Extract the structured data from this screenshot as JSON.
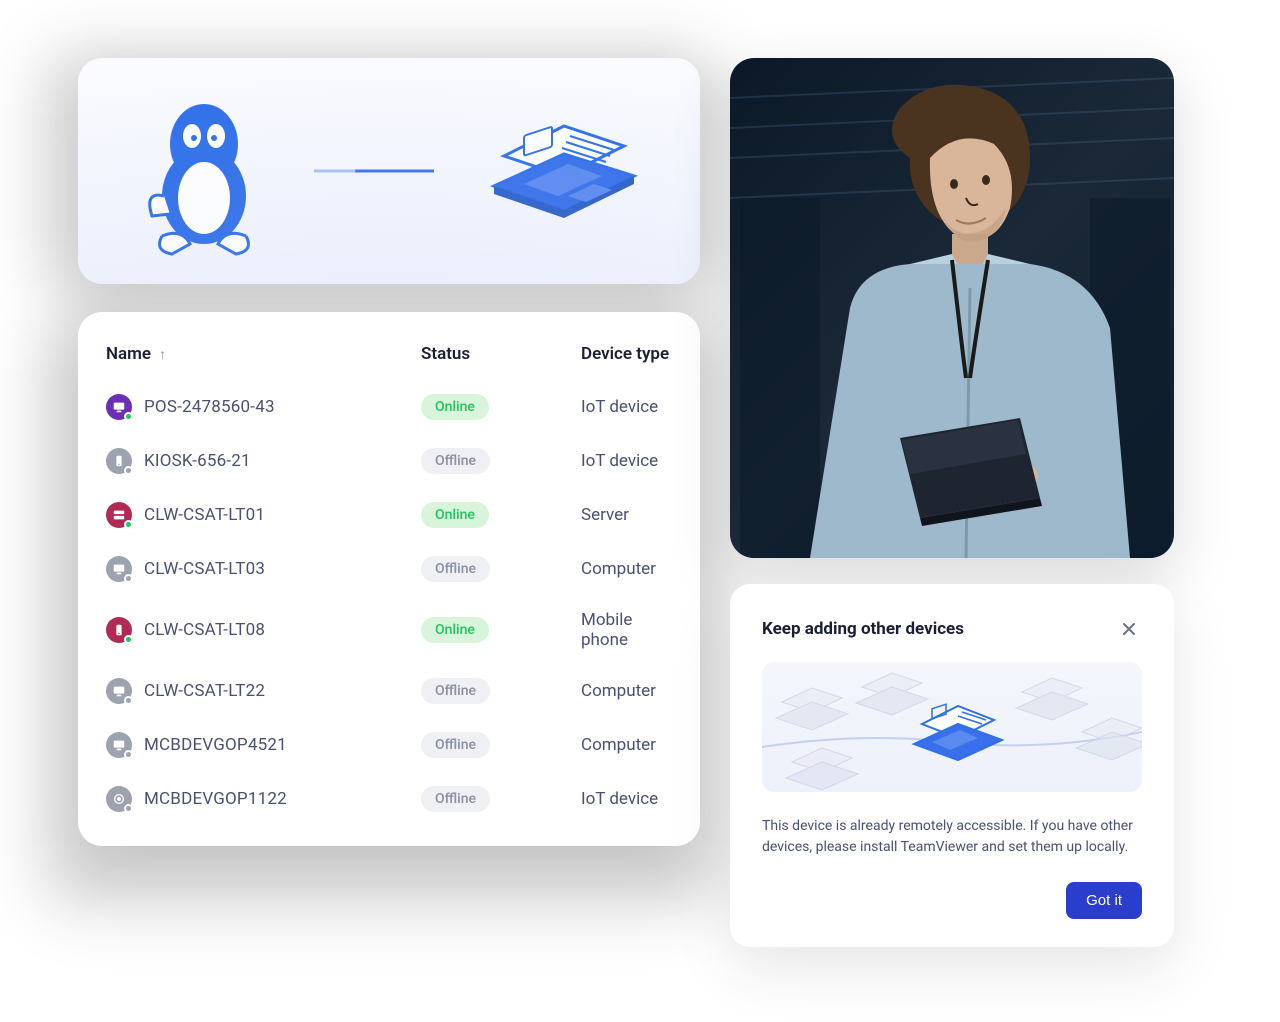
{
  "illustration": {
    "left_icon": "linux-penguin-icon",
    "right_icon": "laptop-icon"
  },
  "device_list": {
    "columns": {
      "name": "Name",
      "status": "Status",
      "type": "Device type"
    },
    "sort_direction": "asc",
    "rows": [
      {
        "name": "POS-2478560-43",
        "status": "Online",
        "type": "IoT device",
        "icon_bg": "#6b2fb5",
        "icon_kind": "monitor"
      },
      {
        "name": "KIOSK-656-21",
        "status": "Offline",
        "type": "IoT device",
        "icon_bg": "#9ca3af",
        "icon_kind": "phone"
      },
      {
        "name": "CLW-CSAT-LT01",
        "status": "Online",
        "type": "Server",
        "icon_bg": "#b02a55",
        "icon_kind": "server"
      },
      {
        "name": "CLW-CSAT-LT03",
        "status": "Offline",
        "type": "Computer",
        "icon_bg": "#9ca3af",
        "icon_kind": "monitor"
      },
      {
        "name": "CLW-CSAT-LT08",
        "status": "Online",
        "type": "Mobile phone",
        "icon_bg": "#b02a55",
        "icon_kind": "phone"
      },
      {
        "name": "CLW-CSAT-LT22",
        "status": "Offline",
        "type": "Computer",
        "icon_bg": "#9ca3af",
        "icon_kind": "monitor"
      },
      {
        "name": "MCBDEVGOP4521",
        "status": "Offline",
        "type": "Computer",
        "icon_bg": "#9ca3af",
        "icon_kind": "monitor"
      },
      {
        "name": "MCBDEVGOP1122",
        "status": "Offline",
        "type": "IoT device",
        "icon_bg": "#9ca3af",
        "icon_kind": "disc"
      }
    ]
  },
  "dialog": {
    "title": "Keep adding other devices",
    "body": "This device is already remotely accessible. If you have other devices, please install TeamViewer and set them up locally.",
    "cta": "Got it"
  },
  "photo_alt": "IT professional in server room holding laptop"
}
